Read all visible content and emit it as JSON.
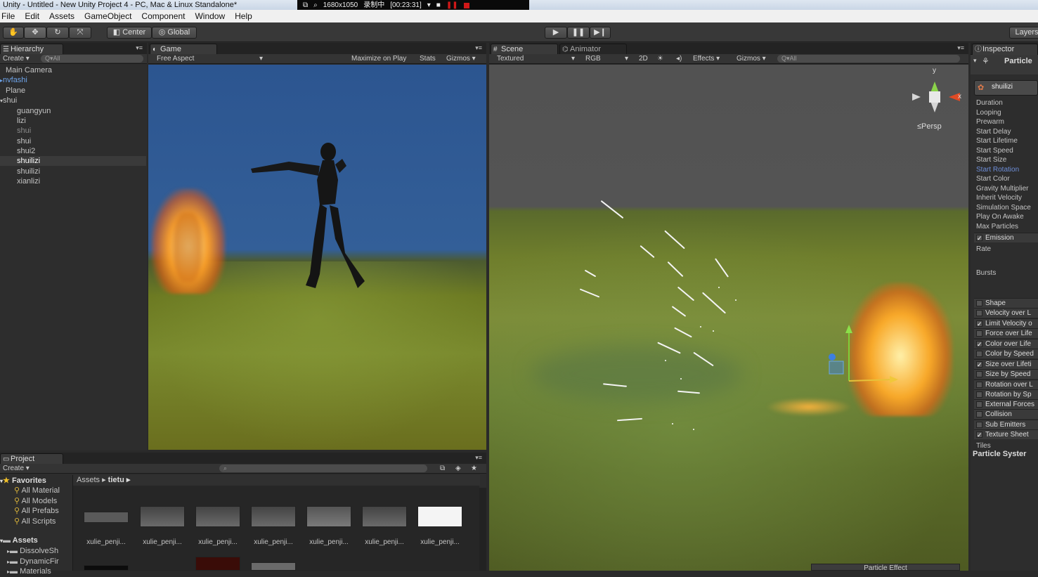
{
  "window": {
    "title": "Unity - Untitled - New Unity Project 4 - PC, Mac & Linux Standalone*"
  },
  "recorder": {
    "resolution": "1680x1050",
    "status": "录制中",
    "time": "[00:23:31]"
  },
  "menu": [
    "File",
    "Edit",
    "Assets",
    "GameObject",
    "Component",
    "Window",
    "Help"
  ],
  "toolbar": {
    "center": "Center",
    "global": "Global",
    "layers": "Layers"
  },
  "hierarchy": {
    "tab": "Hierarchy",
    "create": "Create ▾",
    "search": "Q▾All",
    "items": [
      {
        "label": "Main Camera"
      },
      {
        "label": "nvfashi"
      },
      {
        "label": "Plane"
      },
      {
        "label": "shui"
      },
      {
        "label": "guangyun"
      },
      {
        "label": "lizi"
      },
      {
        "label": "shui"
      },
      {
        "label": "shui"
      },
      {
        "label": "shui2"
      },
      {
        "label": "shuilizi"
      },
      {
        "label": "shuilizi"
      },
      {
        "label": "xianlizi"
      }
    ]
  },
  "game": {
    "tab": "Game",
    "aspect": "Free Aspect",
    "maximize": "Maximize on Play",
    "stats": "Stats",
    "gizmos": "Gizmos ▾"
  },
  "scene": {
    "tab": "Scene",
    "animator_tab": "Animator",
    "shading": "Textured",
    "render_mode": "RGB",
    "mode2d": "2D",
    "effects": "Effects ▾",
    "gizmos": "Gizmos ▾",
    "search": "Q▾All",
    "persp": "≤Persp",
    "axis_y": "y",
    "axis_x": "x",
    "overlay": "Particle Effect"
  },
  "inspector": {
    "tab": "Inspector",
    "header": "Particle",
    "object": "shuilizi",
    "props": [
      "Duration",
      "Looping",
      "Prewarm",
      "Start Delay",
      "Start Lifetime",
      "Start Speed",
      "Start Size",
      "Start Rotation",
      "Start Color",
      "Gravity Multiplier",
      "Inherit Velocity",
      "Simulation Space",
      "Play On Awake",
      "Max Particles"
    ],
    "emission": "Emission",
    "rate": "Rate",
    "bursts": "Bursts",
    "modules": [
      {
        "label": "Shape",
        "checked": false
      },
      {
        "label": "Velocity over L",
        "checked": false
      },
      {
        "label": "Limit Velocity o",
        "checked": true
      },
      {
        "label": "Force over Life",
        "checked": false
      },
      {
        "label": "Color over Life",
        "checked": true
      },
      {
        "label": "Color by Speed",
        "checked": false
      },
      {
        "label": "Size over Lifeti",
        "checked": true
      },
      {
        "label": "Size by Speed",
        "checked": false
      },
      {
        "label": "Rotation over L",
        "checked": false
      },
      {
        "label": "Rotation by Sp",
        "checked": false
      },
      {
        "label": "External Forces",
        "checked": false
      },
      {
        "label": "Collision",
        "checked": false
      },
      {
        "label": "Sub Emitters",
        "checked": false
      },
      {
        "label": "Texture Sheet",
        "checked": true
      }
    ],
    "tiles": "Tiles",
    "footer": "Particle Syster"
  },
  "project": {
    "tab": "Project",
    "create": "Create ▾",
    "breadcrumb_root": "Assets ▸",
    "breadcrumb_folder": "tietu ▸",
    "favorites": "Favorites",
    "fav_items": [
      "All Material",
      "All Models",
      "All Prefabs",
      "All Scripts"
    ],
    "assets": "Assets",
    "asset_folders": [
      "DissolveSh",
      "DynamicFir",
      "Materials"
    ],
    "thumb_labels": [
      "xulie_penji...",
      "xulie_penji...",
      "xulie_penji...",
      "xulie_penji...",
      "xulie_penji...",
      "xulie_penji...",
      "xulie_penji..."
    ]
  },
  "colors": {
    "sky": "#2f5a94",
    "ground": "#66741c",
    "fire": "#ff9a1a",
    "accent_blue": "#6ea3e8"
  }
}
